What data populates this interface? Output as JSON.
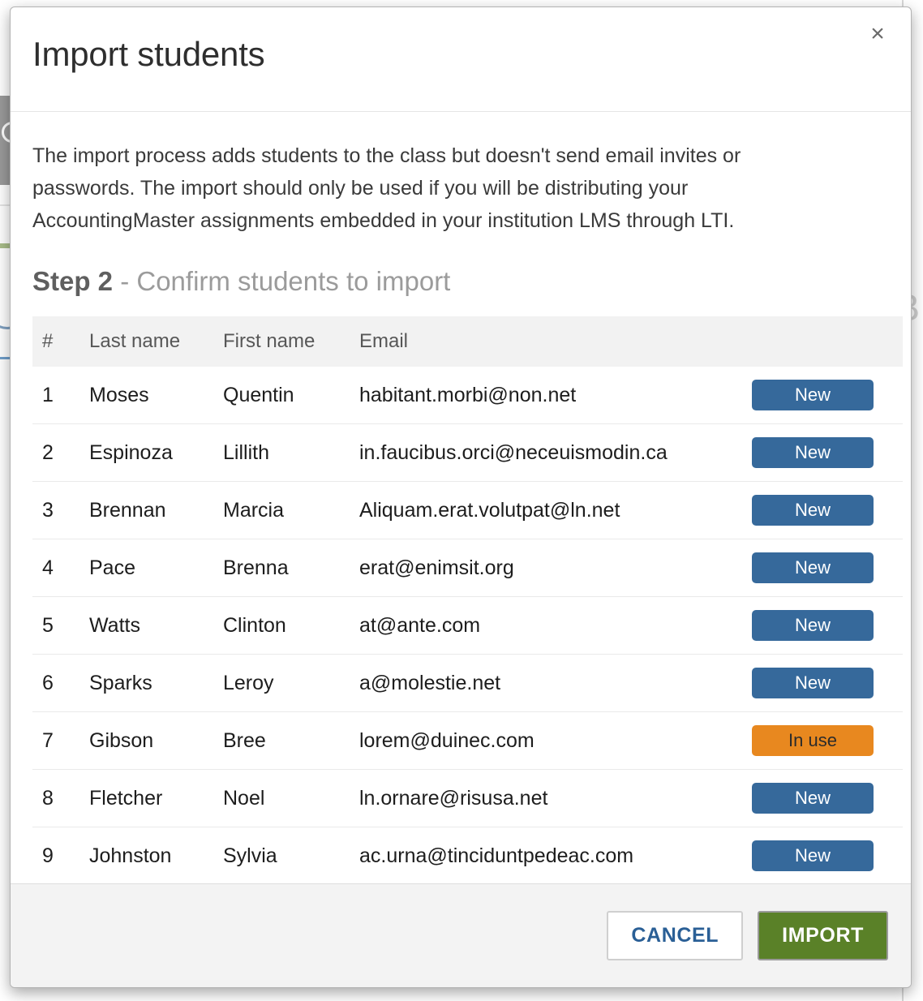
{
  "modal": {
    "title": "Import students",
    "close_icon": "close-icon",
    "close_label": "×",
    "intro": "The import process adds students to the class but doesn't send email invites or passwords. The import should only be used if you will be distributing your AccountingMaster assignments embedded in your institution LMS through LTI.",
    "step": {
      "strong": "Step 2",
      "rest": " - Confirm students to import"
    }
  },
  "table": {
    "columns": [
      "#",
      "Last name",
      "First name",
      "Email",
      ""
    ],
    "rows": [
      {
        "num": "1",
        "last": "Moses",
        "first": "Quentin",
        "email": "habitant.morbi@non.net",
        "status": "New",
        "status_kind": "new"
      },
      {
        "num": "2",
        "last": "Espinoza",
        "first": "Lillith",
        "email": "in.faucibus.orci@neceuismodin.ca",
        "status": "New",
        "status_kind": "new"
      },
      {
        "num": "3",
        "last": "Brennan",
        "first": "Marcia",
        "email": "Aliquam.erat.volutpat@ln.net",
        "status": "New",
        "status_kind": "new"
      },
      {
        "num": "4",
        "last": "Pace",
        "first": "Brenna",
        "email": "erat@enimsit.org",
        "status": "New",
        "status_kind": "new"
      },
      {
        "num": "5",
        "last": "Watts",
        "first": "Clinton",
        "email": "at@ante.com",
        "status": "New",
        "status_kind": "new"
      },
      {
        "num": "6",
        "last": "Sparks",
        "first": "Leroy",
        "email": "a@molestie.net",
        "status": "New",
        "status_kind": "new"
      },
      {
        "num": "7",
        "last": "Gibson",
        "first": "Bree",
        "email": "lorem@duinec.com",
        "status": "In use",
        "status_kind": "inuse"
      },
      {
        "num": "8",
        "last": "Fletcher",
        "first": "Noel",
        "email": "ln.ornare@risusa.net",
        "status": "New",
        "status_kind": "new"
      },
      {
        "num": "9",
        "last": "Johnston",
        "first": "Sylvia",
        "email": "ac.urna@tinciduntpedeac.com",
        "status": "New",
        "status_kind": "new"
      }
    ]
  },
  "footer": {
    "cancel_label": "CANCEL",
    "import_label": "IMPORT"
  },
  "colors": {
    "badge_new": "#36699b",
    "badge_in_use": "#e8881f",
    "import_green": "#5a8128",
    "cancel_blue": "#2a5f96",
    "header_row": "#f2f2f2",
    "footer_bg": "#f3f3f3"
  },
  "backdrop": {
    "faint_letter": "B"
  }
}
